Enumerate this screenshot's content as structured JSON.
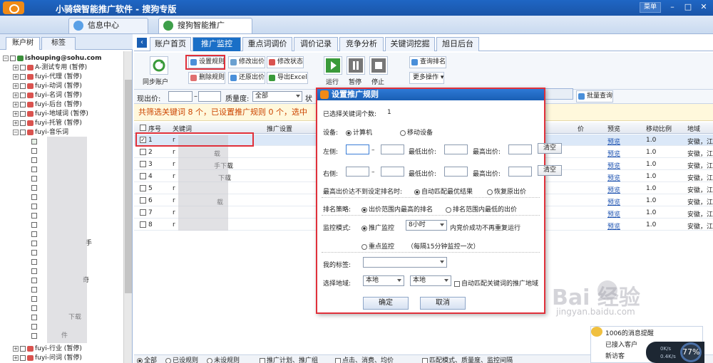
{
  "app": {
    "title": "小骑袋智能推广软件 - 搜狗专版",
    "menu_label": "菜单",
    "win_min": "–",
    "win_max": "□",
    "win_close": "✕"
  },
  "main_tabs": [
    {
      "label": "信息中心"
    },
    {
      "label": "搜狗智能推广"
    }
  ],
  "left": {
    "tabs": [
      "账户树",
      "标签"
    ],
    "account": "ishouping@sohu.com",
    "items": [
      "A-测试专用 (暂停)",
      "fuyi-代理 (暂停)",
      "fuyi-动词 (暂停)",
      "fuyi-名词 (暂停)",
      "fuyi-后台 (暂停)",
      "fuyi-地域词 (暂停)",
      "fuyi-托管 (暂停)",
      "fuyi-音乐词"
    ],
    "bottom_items": [
      "fuyi-行业 (暂停)",
      "fuyi-问词 (暂停)"
    ],
    "visible_fragments": [
      "手",
      "奇",
      "下载",
      "件"
    ]
  },
  "subtabs": [
    "账户首页",
    "推广监控",
    "重点词调价",
    "调价记录",
    "竞争分析",
    "关键词挖掘",
    "旭日后台"
  ],
  "toolbar": {
    "sync": "同步账户",
    "set_rule": "设置规则",
    "edit_bid": "修改出价",
    "edit_status": "修改状态",
    "delete_rule": "删除规则",
    "restore_bid": "还原出价",
    "export_excel": "导出Excel",
    "run": "运行",
    "pause": "暂停",
    "stop": "停止",
    "query_rank": "查询排名",
    "more_ops": "更多操作",
    "batch_query": "批量查询"
  },
  "filter": {
    "bid_label": "现出价:",
    "dash": "–",
    "quality_label": "质量度:",
    "quality_value": "全部",
    "status_label": "状"
  },
  "summary": "共筛选关键词 8 个，已设置推广规则 0 个，选中",
  "table": {
    "headers": [
      "序号",
      "关键词",
      "推广设置",
      "价",
      "预览",
      "移动比例",
      "地域"
    ],
    "rows": [
      {
        "no": "1",
        "kw": "r",
        "preview": "预览",
        "ratio": "1.0",
        "region": "安徽，江"
      },
      {
        "no": "2",
        "kw": "r",
        "preview": "预览",
        "ratio": "1.0",
        "region": "安徽，江"
      },
      {
        "no": "3",
        "kw": "r",
        "kw_suffix": "手下载",
        "preview": "预览",
        "ratio": "1.0",
        "region": "安徽，江"
      },
      {
        "no": "4",
        "kw": "r",
        "kw_suffix": "下载",
        "preview": "预览",
        "ratio": "1.0",
        "region": "安徽，江"
      },
      {
        "no": "5",
        "kw": "r",
        "preview": "预览",
        "ratio": "1.0",
        "region": "安徽，江"
      },
      {
        "no": "6",
        "kw": "r",
        "kw_suffix": "载",
        "preview": "预览",
        "ratio": "1.0",
        "region": "安徽，江"
      },
      {
        "no": "7",
        "kw": "r",
        "preview": "预览",
        "ratio": "1.0",
        "region": "安徽，江"
      },
      {
        "no": "8",
        "kw": "r",
        "preview": "预览",
        "ratio": "1.0",
        "region": "安徽，江"
      }
    ],
    "row1_check": "✓",
    "row2_kw_suffix": "载"
  },
  "bottom": {
    "all": "全部",
    "set": "已设规则",
    "unset": "未设规则",
    "plan_group": "推广计划、推广组",
    "click_cost": "点击、消费、均价",
    "match_quality": "匹配模式、质量度、监控间隔"
  },
  "dialog": {
    "title": "设置推广规则",
    "selected_label": "已选择关键词个数:",
    "selected_count": "1",
    "device_label": "设备:",
    "device_pc": "计算机",
    "device_mobile": "移动设备",
    "left_label": "左侧:",
    "right_label": "右侧:",
    "dash": "–",
    "min_bid": "最低出价:",
    "max_bid": "最高出价:",
    "clear": "清空",
    "maxbid_label": "最高出价达不到设定排名时:",
    "auto_match": "自动匹配最优结果",
    "restore_bid": "恢复原出价",
    "strategy_label": "排名策略:",
    "strategy_high": "出价范围内最高的排名",
    "strategy_low": "排名范围内最低的出价",
    "monitor_label": "监控模式:",
    "monitor_promo": "推广监控",
    "interval": "8小时",
    "no_rerun": "内竞价成功不再重复运行",
    "key_monitor": "重点监控",
    "key_note": "（每隔15分钟监控一次）",
    "tag_label": "我的标签:",
    "region_label": "选择地域:",
    "region_1": "本地",
    "region_2": "本地",
    "auto_region": "自动匹配关键词的推广地域",
    "ok": "确定",
    "cancel": "取消"
  },
  "watermark": {
    "text": "Bai 经验",
    "url": "jingyan.baidu.com"
  },
  "notify": {
    "title": "1006的消息提醒",
    "line1": "已接入客户",
    "line2": "新访客",
    "speed_up": "0K/s",
    "speed_down": "0.4K/s",
    "percent": "77%"
  }
}
